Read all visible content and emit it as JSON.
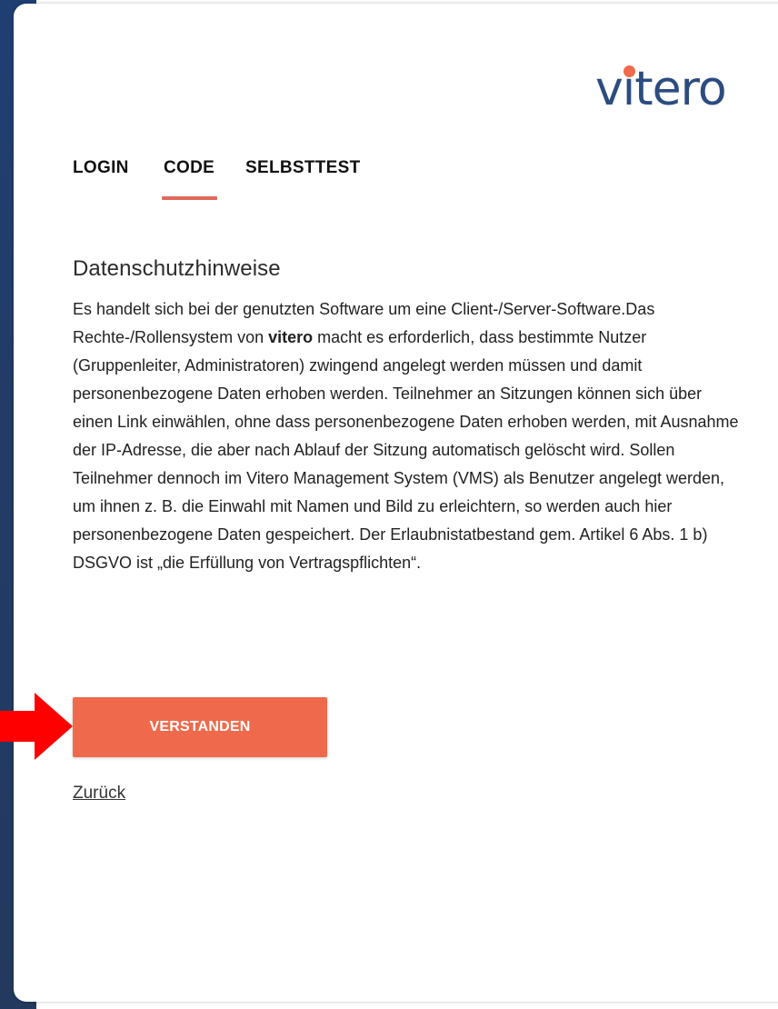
{
  "logo": {
    "text_before_i": "v",
    "text_i": "ı",
    "text_after_i": "tero",
    "dot_color": "#f06a4c",
    "color": "#2c4c80"
  },
  "tabs": [
    {
      "label": "LOGIN",
      "active": false
    },
    {
      "label": "CODE",
      "active": true
    },
    {
      "label": "SELBSTTEST",
      "active": false
    }
  ],
  "section": {
    "title": "Datenschutzhinweise",
    "text_part1": "Es handelt sich bei der genutzten Software um eine Client-/Server-Software.Das Rechte-/Rollensystem von ",
    "text_bold": "vitero",
    "text_part2": " macht es erforderlich, dass bestimmte Nutzer (Gruppenleiter, Administratoren) zwingend angelegt werden müssen und damit personenbezogene Daten erhoben werden. Teilnehmer an Sitzungen können sich über einen Link einwählen, ohne dass personenbezogene Daten erhoben werden, mit Ausnahme der IP-Adresse, die aber nach Ablauf der Sitzung automatisch gelöscht wird. Sollen Teilnehmer dennoch im Vitero Management System (VMS) als Benutzer angelegt werden, um ihnen z. B. die Einwahl mit Namen und Bild zu erleichtern, so werden auch hier personenbezogene Daten gespeichert. Der Erlaubnistatbestand gem. Artikel 6 Abs. 1 b) DSGVO ist „die Erfüllung von Vertragspflichten“."
  },
  "buttons": {
    "confirm_label": "VERSTANDEN"
  },
  "links": {
    "back_label": "Zurück"
  },
  "colors": {
    "accent": "#ef6a4c",
    "tab_underline": "#e2685a",
    "arrow": "#ff0000",
    "background_edge": "#223c66"
  },
  "annotation": {
    "icon": "red-arrow-right"
  }
}
